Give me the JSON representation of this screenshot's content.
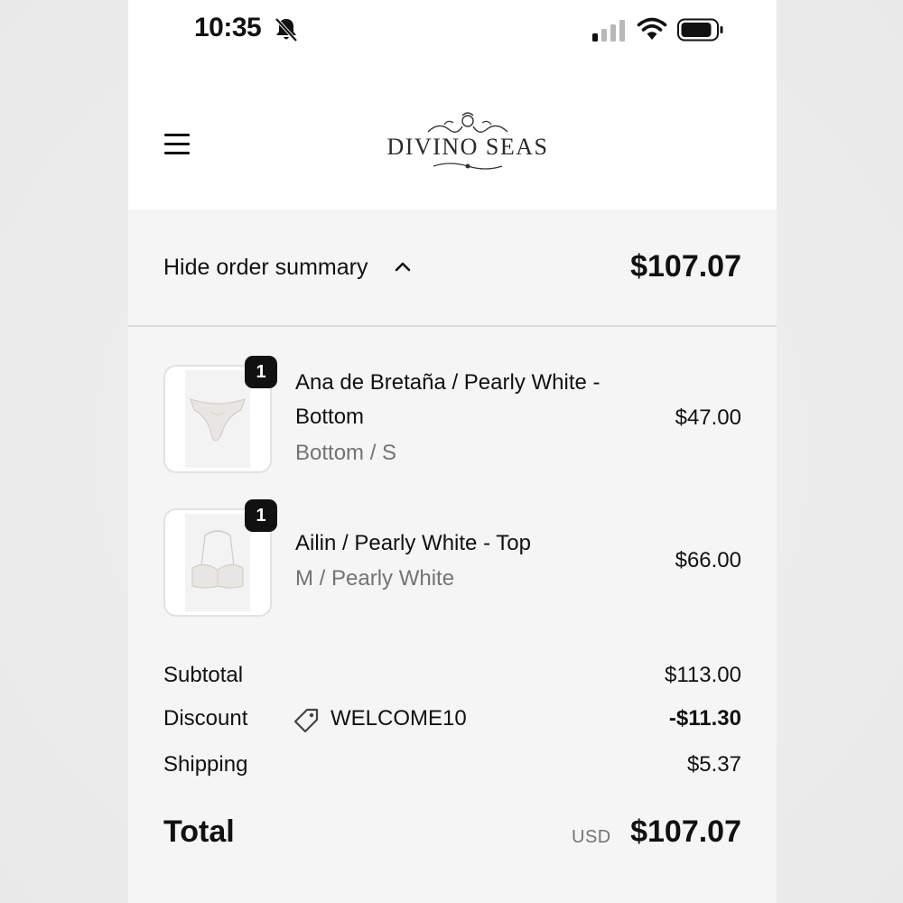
{
  "status_bar": {
    "time": "10:35",
    "icons": [
      "bell-slash-icon",
      "cellular-signal-icon",
      "wifi-icon",
      "battery-icon"
    ]
  },
  "header": {
    "menu_icon": "hamburger-menu-icon",
    "logo_text": "DIVINO SEAS"
  },
  "summary": {
    "toggle_label": "Hide order summary",
    "toggle_icon": "chevron-up-icon",
    "total": "$107.07"
  },
  "items": [
    {
      "title_line1": "Ana de Bretaña / Pearly White -",
      "title_line2": "Bottom",
      "variant": "Bottom / S",
      "price": "$47.00",
      "quantity": "1"
    },
    {
      "title_line1": "Ailin / Pearly White - Top",
      "variant": "M / Pearly White",
      "price": "$66.00",
      "quantity": "1"
    }
  ],
  "totals": {
    "subtotal_label": "Subtotal",
    "subtotal_value": "$113.00",
    "discount_label": "Discount",
    "discount_code": "WELCOME10",
    "discount_icon": "tag-icon",
    "discount_value": "-$11.30",
    "shipping_label": "Shipping",
    "shipping_value": "$5.37",
    "total_label": "Total",
    "total_currency": "USD",
    "total_value": "$107.07"
  },
  "colors": {
    "background": "#f5f5f5",
    "header_background": "#ffffff",
    "text": "#111111",
    "muted_text": "#737373",
    "badge": "#111111"
  }
}
